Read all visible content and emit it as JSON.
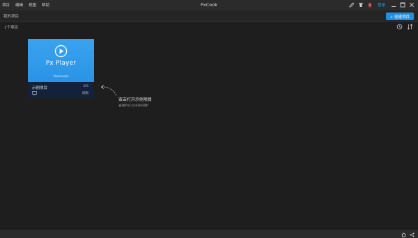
{
  "app": {
    "title": "PxCook"
  },
  "menu": {
    "items": [
      "项目",
      "编辑",
      "视图",
      "帮助"
    ]
  },
  "titlebar": {
    "login_label": "登录"
  },
  "toolbar": {
    "breadcrumb": "我的项目",
    "create_label": "+ 创建项目"
  },
  "subbar": {
    "count": "1个项目"
  },
  "project": {
    "thumb_brand": "Px Player",
    "thumb_vendor": "Userconic",
    "name": "示例项目",
    "platform": "iOS",
    "date": "刚刚"
  },
  "hint": {
    "title": "双击打开示例项目",
    "subtitle": "查看PxCook多好用!"
  },
  "colors": {
    "accent": "#1f8fe3",
    "login": "#2d9cdb",
    "background": "#1e1e1e",
    "card_footer": "#13213a"
  },
  "icons": {
    "titlebar": [
      "pencil-icon",
      "shirt-icon",
      "bell-icon"
    ],
    "window": [
      "minimize-icon",
      "maximize-icon",
      "close-icon"
    ],
    "subbar": [
      "history-icon",
      "sort-icon"
    ],
    "status": [
      "home-icon",
      "share-icon"
    ]
  }
}
